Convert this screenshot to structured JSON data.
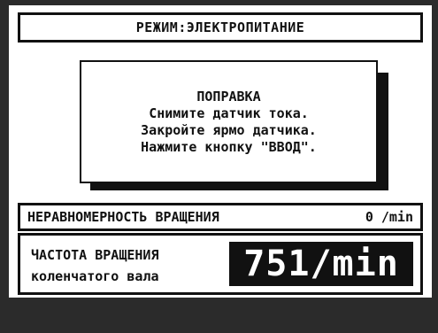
{
  "mode": {
    "label": "РЕЖИМ:ЭЛЕКТРОПИТАНИЕ"
  },
  "dialog": {
    "title": "ПОПРАВКА",
    "lines": [
      "Снимите датчик тока.",
      "Закройте ярмо датчика.",
      "Нажмите кнопку \"ВВОД\"."
    ]
  },
  "rotation_unevenness": {
    "label": "НЕРАВНОМЕРНОСТЬ ВРАЩЕНИЯ",
    "value": "0 /min"
  },
  "crankshaft_speed": {
    "label_line1": "ЧАСТОТА ВРАЩЕНИЯ",
    "label_line2": "коленчатого вала",
    "value": "751/min"
  },
  "colors": {
    "background": "#ffffff",
    "foreground": "#111111",
    "bezel": "#2b2b2b"
  }
}
